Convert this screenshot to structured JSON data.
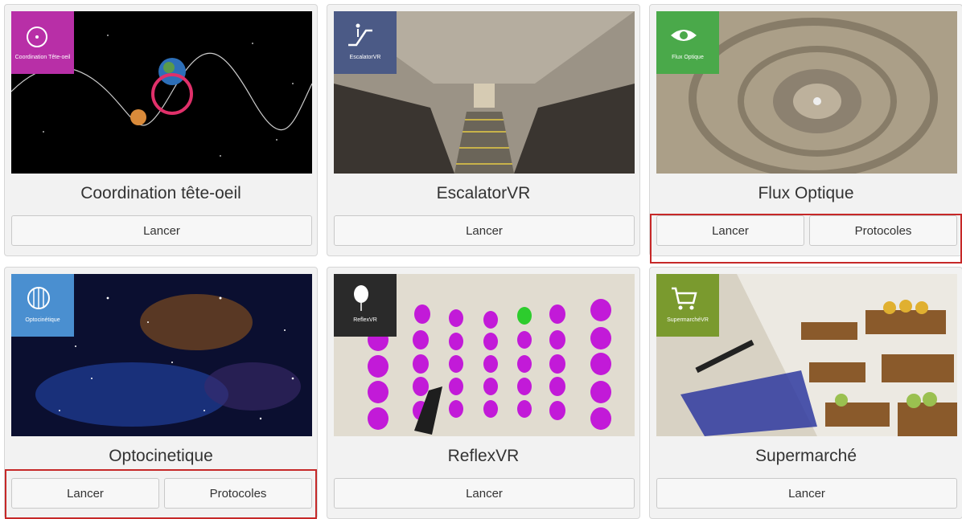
{
  "cards": [
    {
      "title": "Coordination tête-oeil",
      "badge": "Coordination Tête-oeil",
      "badge_color": "#b82fa7",
      "buttons": [
        "Lancer"
      ]
    },
    {
      "title": "EscalatorVR",
      "badge": "EscalatorVR",
      "badge_color": "#4b5a86",
      "buttons": [
        "Lancer"
      ]
    },
    {
      "title": "Flux Optique",
      "badge": "Flux Optique",
      "badge_color": "#4aa94a",
      "buttons": [
        "Lancer",
        "Protocoles"
      ]
    },
    {
      "title": "Optocinetique",
      "badge": "Optocinétique",
      "badge_color": "#4a8fd0",
      "buttons": [
        "Lancer",
        "Protocoles"
      ]
    },
    {
      "title": "ReflexVR",
      "badge": "ReflexVR",
      "badge_color": "#2a2a2a",
      "buttons": [
        "Lancer"
      ]
    },
    {
      "title": "Supermarché",
      "badge": "SupermarchéVR",
      "badge_color": "#7a9a2e",
      "buttons": [
        "Lancer"
      ]
    }
  ],
  "highlight_color": "#c62828"
}
